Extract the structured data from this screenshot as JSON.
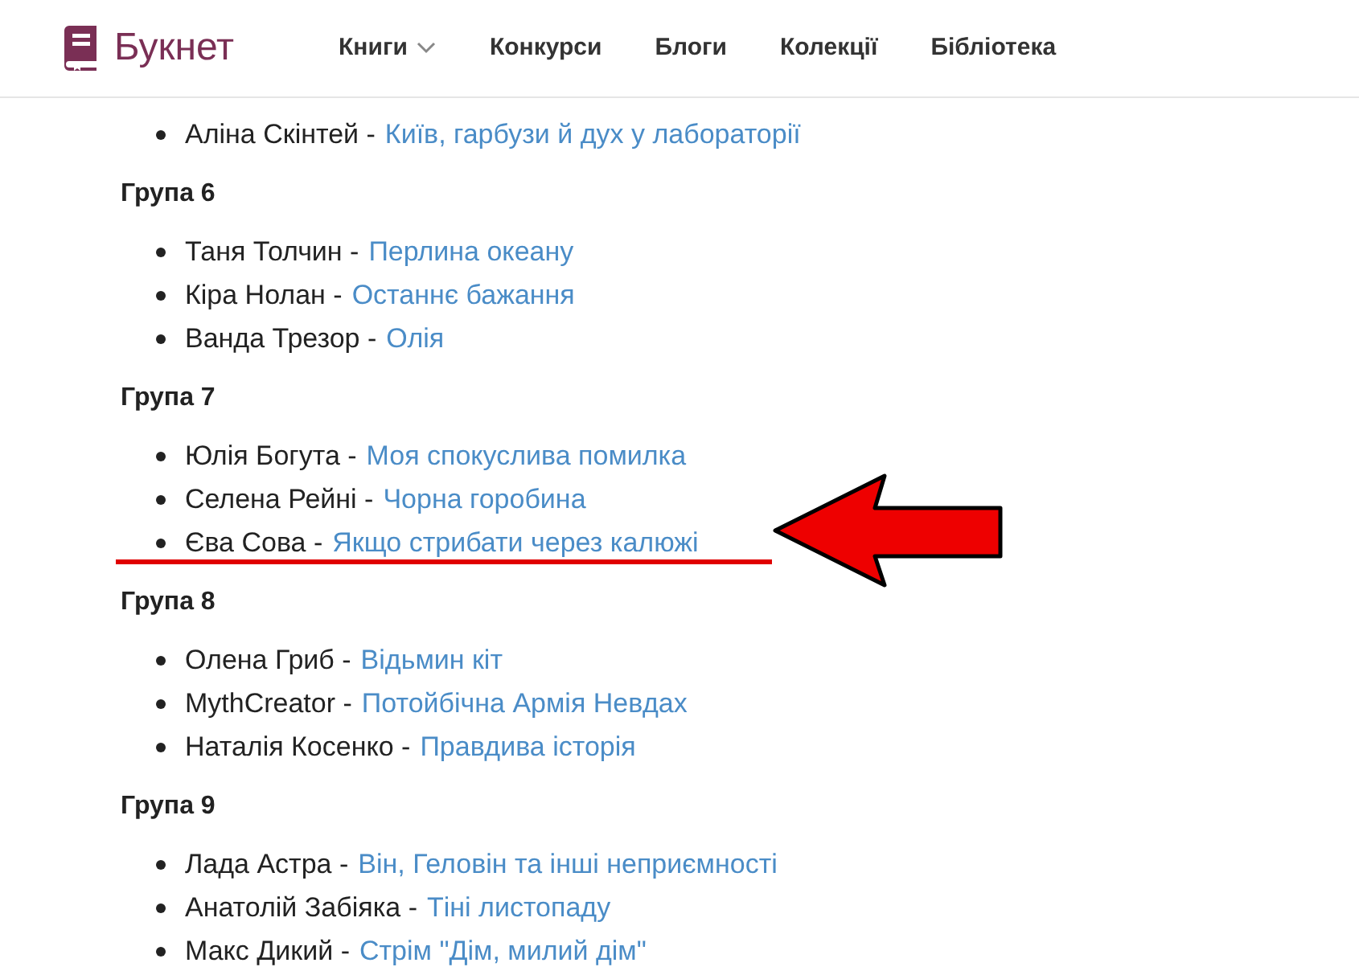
{
  "header": {
    "logo_text": "Букнет",
    "nav": [
      {
        "label": "Книги",
        "kind": "dropdown"
      },
      {
        "label": "Конкурси",
        "kind": "link"
      },
      {
        "label": "Блоги",
        "kind": "link"
      },
      {
        "label": "Колекції",
        "kind": "link"
      },
      {
        "label": "Бібліотека",
        "kind": "link"
      }
    ]
  },
  "groups": [
    {
      "items": [
        {
          "author": "Аліна Скінтей -",
          "title": "Київ, гарбузи й дух у лабораторії",
          "highlighted": false
        }
      ]
    },
    {
      "heading": "Група 6",
      "items": [
        {
          "author": "Таня Толчин -",
          "title": "Перлина океану",
          "highlighted": false
        },
        {
          "author": "Кіра Нолан -",
          "title": "Останнє бажання",
          "highlighted": false
        },
        {
          "author": "Ванда Трезор -",
          "title": "Олія",
          "highlighted": false
        }
      ]
    },
    {
      "heading": "Група 7",
      "items": [
        {
          "author": "Юлія Богута -",
          "title": "Моя спокуслива помилка",
          "highlighted": false
        },
        {
          "author": "Селена Рейні -",
          "title": "Чорна горобина",
          "highlighted": false
        },
        {
          "author": "Єва Сова -",
          "title": "Якщо стрибати через калюжі",
          "highlighted": true
        }
      ]
    },
    {
      "heading": "Група 8",
      "items": [
        {
          "author": "Олена Гриб -",
          "title": "Відьмин кіт",
          "highlighted": false
        },
        {
          "author": "MythCreator -",
          "title": "Потойбічна Армія Невдах",
          "highlighted": false
        },
        {
          "author": "Наталія Косенко -",
          "title": "Правдива історія",
          "highlighted": false
        }
      ]
    },
    {
      "heading": "Група 9",
      "items": [
        {
          "author": "Лада Астра -",
          "title": "Він, Геловін та інші неприємності",
          "highlighted": false
        },
        {
          "author": "Анатолій Забіяка -",
          "title": "Тіні листопаду",
          "highlighted": false
        },
        {
          "author": "Макс Дикий -",
          "title": "Стрім \"Дім, милий дім\"",
          "highlighted": false
        }
      ]
    }
  ]
}
